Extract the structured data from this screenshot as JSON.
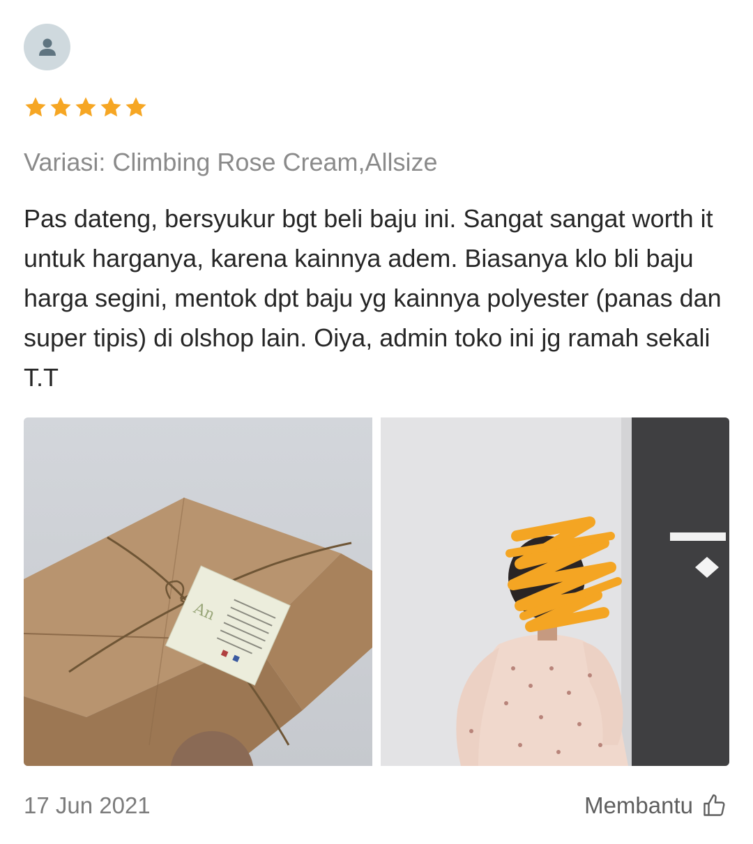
{
  "reviewer": {
    "avatar_icon": "user-icon"
  },
  "rating": {
    "stars": 5,
    "max": 5,
    "star_color": "#f6a623"
  },
  "variation": "Variasi: Climbing Rose Cream,Allsize",
  "review_text": "Pas dateng, bersyukur bgt beli baju ini. Sangat sangat worth it untuk harganya, karena kainnya adem. Biasanya klo bli baju harga segini, mentok dpt baju yg kainnya polyester (panas dan super tipis) di olshop lain. Oiya, admin toko ini jg ramah sekali T.T",
  "photos": [
    {
      "name": "review-photo-package"
    },
    {
      "name": "review-photo-dress"
    }
  ],
  "date": "17 Jun 2021",
  "helpful": {
    "label": "Membantu",
    "icon": "thumbs-up-icon"
  }
}
